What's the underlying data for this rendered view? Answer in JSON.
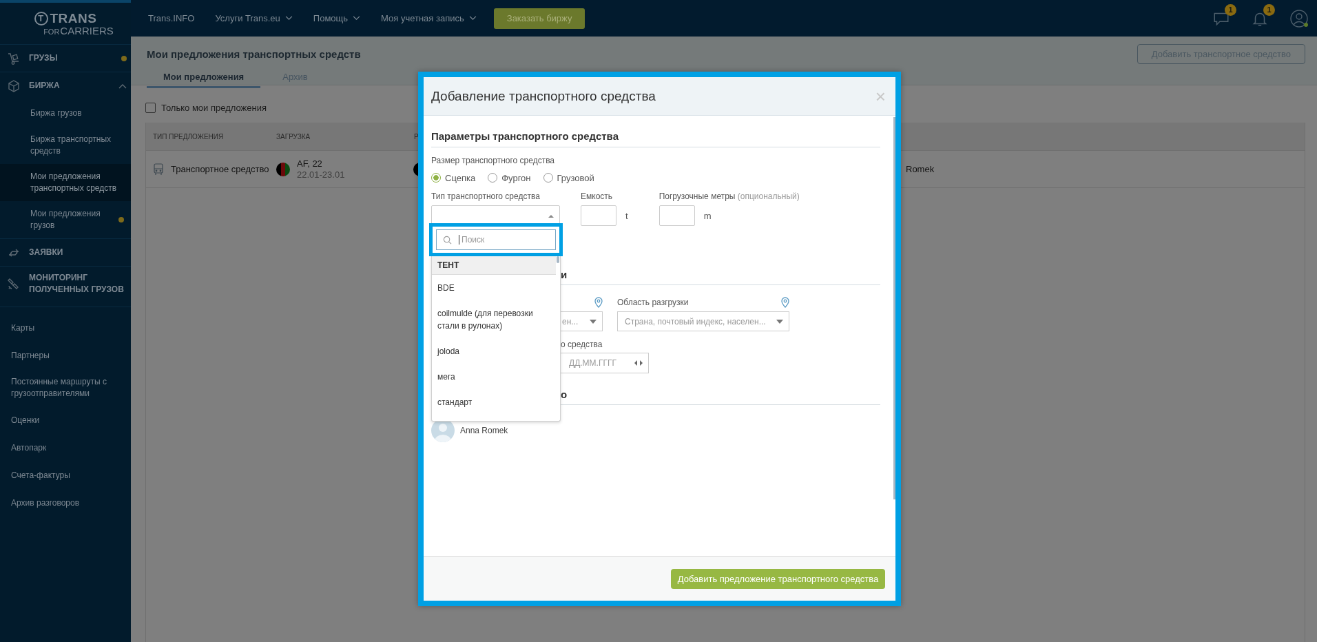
{
  "logo": {
    "mark": "T",
    "name": "TRANS",
    "sub_prefix": "FOR",
    "sub": "CARRIERS"
  },
  "topbar": {
    "nav": [
      {
        "label": "Trans.INFO",
        "dropdown": false
      },
      {
        "label": "Услуги Trans.eu",
        "dropdown": true
      },
      {
        "label": "Помощь",
        "dropdown": true
      },
      {
        "label": "Моя учетная запись",
        "dropdown": true
      }
    ],
    "cta": "Заказать биржу",
    "messages_badge": "1",
    "notifications_badge": "1",
    "user_online": true
  },
  "sidebar": {
    "sections": [
      {
        "label": "ГРУЗЫ",
        "dot": true
      },
      {
        "label": "БИРЖА",
        "dot": false,
        "expanded": true,
        "children": [
          {
            "label": "Биржа грузов",
            "selected": false,
            "dot": false
          },
          {
            "label": "Биржа транспортных средств",
            "selected": false,
            "dot": false
          },
          {
            "label": "Мои предложения транспортных средств",
            "selected": true,
            "dot": false
          },
          {
            "label": "Мои предложения грузов",
            "selected": false,
            "dot": true
          }
        ]
      },
      {
        "label": "ЗАЯВКИ",
        "dot": false
      },
      {
        "label": "МОНИТОРИНГ ПОЛУЧЕННЫХ ГРУЗОВ",
        "dot": false
      }
    ],
    "links": [
      "Карты",
      "Партнеры",
      "Постоянные маршруты с грузоотправителями",
      "Оценки",
      "Автопарк",
      "Счета-фактуры",
      "Архив разговоров"
    ]
  },
  "page": {
    "title": "Мои предложения транспортных средств",
    "add_button": "Добавить транспортное средство",
    "tabs": [
      {
        "label": "Мои предложения",
        "selected": true
      },
      {
        "label": "Архив",
        "selected": false
      }
    ],
    "filter": {
      "label": "Только мои предложения",
      "checked": false
    },
    "table": {
      "columns": [
        "ТИП ПРЕДЛОЖЕНИЯ",
        "ЗАГРУЗКА",
        "Р"
      ],
      "rows": [
        {
          "type": "Транспортное средство",
          "loading_place": "AF, 22",
          "loading_dates": "22.01-23.01",
          "column_5": "Romek"
        }
      ]
    }
  },
  "modal": {
    "title": "Добавление транспортного средства",
    "close": "×",
    "section_1": "Параметры транспортного средства",
    "size_label": "Размер транспортного средства",
    "sizes": [
      {
        "label": "Сцепка",
        "selected": true
      },
      {
        "label": "Фургон",
        "selected": false
      },
      {
        "label": "Грузовой",
        "selected": false
      }
    ],
    "type_label": "Тип транспортного средства",
    "capacity_label": "Емкость",
    "capacity_unit": "t",
    "meters_label": "Погрузочные метры",
    "meters_hint": "(опциональный)",
    "meters_unit": "m",
    "dropdown": {
      "placeholder": "Поиск",
      "items": [
        {
          "kind": "group",
          "label": "ТЕНТ"
        },
        {
          "kind": "option",
          "label": "BDE"
        },
        {
          "kind": "option",
          "label": "coilmulde (для перевозки стали в рулонах)"
        },
        {
          "kind": "option",
          "label": "joloda"
        },
        {
          "kind": "option",
          "label": "мега"
        },
        {
          "kind": "option",
          "label": "стандарт"
        }
      ]
    },
    "section_2_fragment": "и",
    "load_field_fragment": "ен...",
    "unload_label": "Область разгрузки",
    "unload_placeholder": "Страна, почтовый индекс, населен...",
    "date_label_fragment": "о средства",
    "date_placeholder": "ДД.ММ.ГГГГ",
    "section_3_fragment": "о",
    "contact_name": "Anna Romek",
    "submit": "Добавить предложение транспортного средства"
  }
}
